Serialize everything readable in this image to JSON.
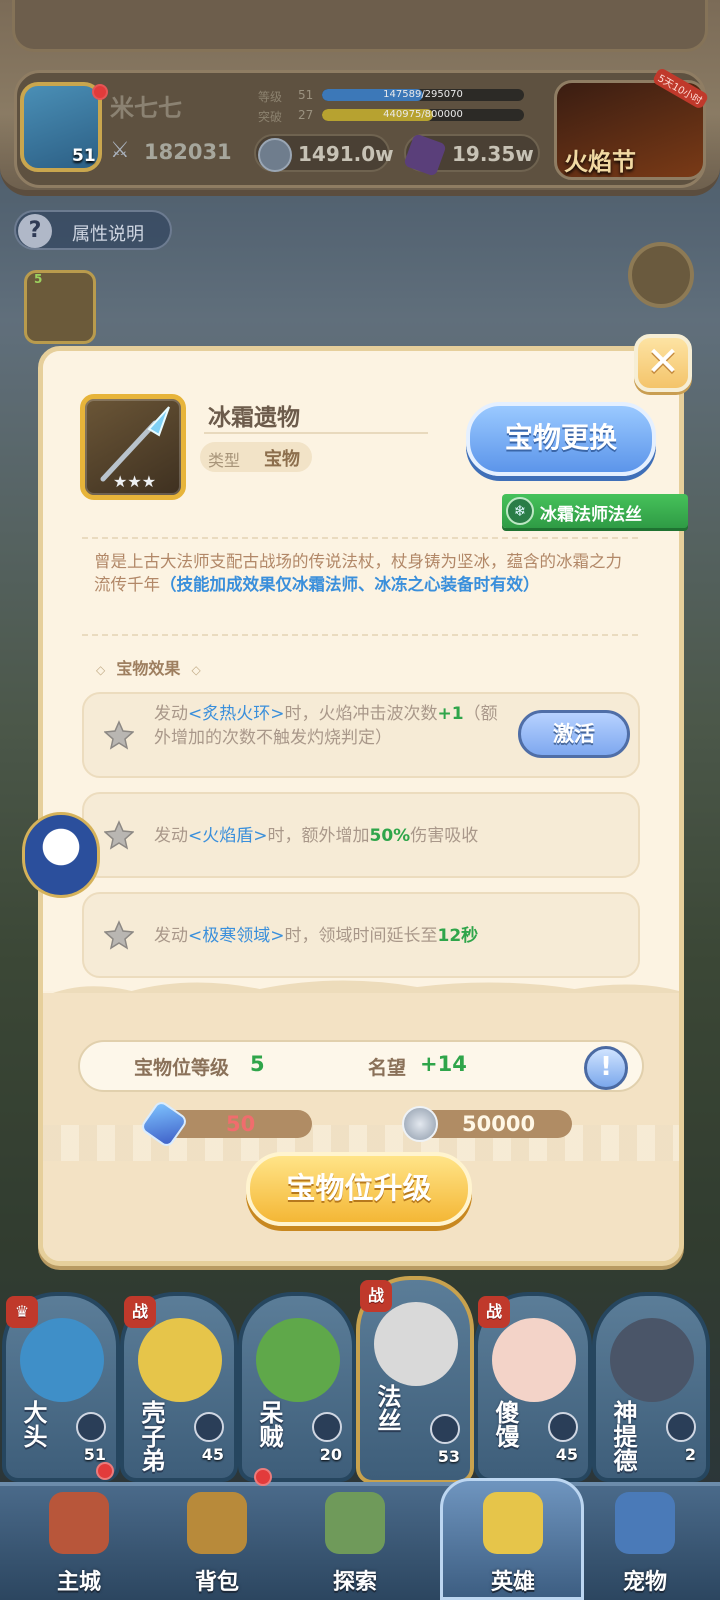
{
  "header": {
    "player_name": "米七七",
    "avatar_level": "51",
    "power": "182031",
    "level_label": "等级",
    "level_value": "51",
    "level_exp": "147589/295070",
    "level_fraction": 0.5,
    "breakthrough_label": "突破",
    "breakthrough_value": "27",
    "breakthrough_exp": "440975/800000",
    "breakthrough_fraction": 0.55,
    "coins": "1491.0w",
    "crystals": "19.35w",
    "event_name": "火焰节",
    "event_badge": "5天10小时"
  },
  "attr_button": {
    "icon": "question-icon",
    "label": "属性说明"
  },
  "slot": {
    "level": "5"
  },
  "item": {
    "name": "冰霜遗物",
    "type_label": "类型",
    "type_value": "宝物",
    "swap_button": "宝物更换",
    "owner_tag": "冰霜法师法丝",
    "description": "曾是上古大法师支配古战场的传说法杖，杖身铸为坚冰，蕴含的冰霜之力流传千年",
    "description_highlight": "（技能加成效果仅冰霜法师、冰冻之心装备时有效）"
  },
  "effects": {
    "title": "宝物效果",
    "list": [
      {
        "prefix": "发动",
        "skill": "<炙热火环>",
        "middle": "时，火焰冲击波次数",
        "num": "+1",
        "suffix": "（额外增加的次数不触发灼烧判定）"
      },
      {
        "prefix": "发动",
        "skill": "<火焰盾>",
        "middle": "时，额外增加",
        "num": "50%",
        "suffix": "伤害吸收"
      },
      {
        "prefix": "发动",
        "skill": "<极寒领域>",
        "middle": "时，领域时间延长至",
        "num": "12秒",
        "suffix": ""
      }
    ],
    "activate_button": "激活"
  },
  "upgrade": {
    "slot_level_label": "宝物位等级",
    "slot_level_value": "5",
    "fame_label": "名望",
    "fame_value": "+14",
    "gem_cost": "50",
    "coin_cost": "50000",
    "button": "宝物位升级"
  },
  "heroes": [
    {
      "name": "大头",
      "level": "51",
      "color": "#3f8fc8",
      "tag": "crown"
    },
    {
      "name": "壳子弟",
      "level": "45",
      "color": "#e6c54a",
      "tag": "战"
    },
    {
      "name": "呆贼",
      "level": "20",
      "color": "#5fa84a",
      "tag": ""
    },
    {
      "name": "法丝",
      "level": "53",
      "color": "#d9d9d9",
      "tag": "战"
    },
    {
      "name": "傻馒",
      "level": "45",
      "color": "#f3d3c8",
      "tag": "战"
    },
    {
      "name": "神提德",
      "level": "2",
      "color": "#4a5568",
      "tag": ""
    }
  ],
  "nav": [
    {
      "label": "主城",
      "icon": "castle-icon"
    },
    {
      "label": "背包",
      "icon": "backpack-icon"
    },
    {
      "label": "探索",
      "icon": "map-icon"
    },
    {
      "label": "英雄",
      "icon": "hero-icon"
    },
    {
      "label": "宠物",
      "icon": "pet-icon"
    }
  ],
  "colors": {
    "accent_blue": "#5c95ea",
    "accent_gold": "#f4b736",
    "accent_green": "#2fa54a",
    "skill_blue": "#3a8fdb"
  }
}
